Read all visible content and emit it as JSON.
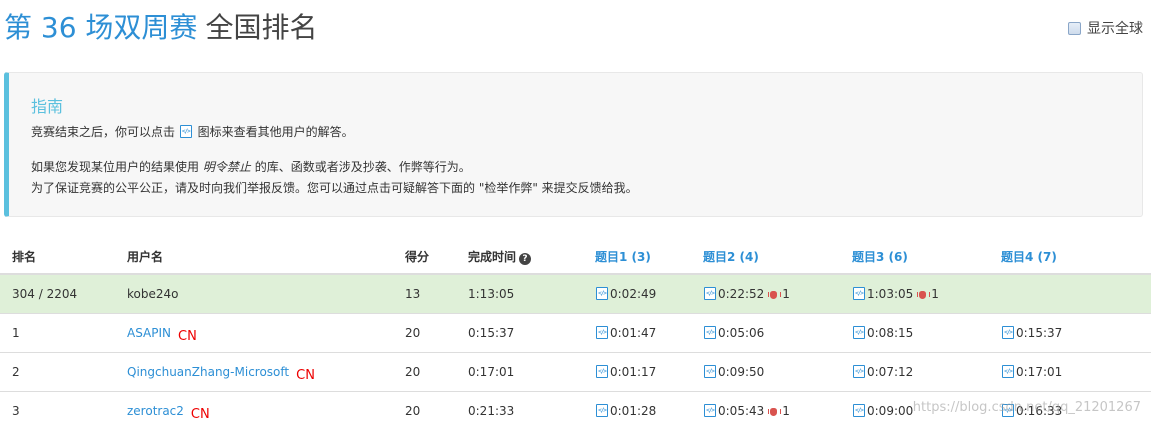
{
  "header": {
    "contest_title": "第 36 场双周赛",
    "rank_title": "全国排名",
    "show_global_label": "显示全球"
  },
  "guide": {
    "title": "指南",
    "line1_before": "竞赛结束之后，你可以点击",
    "line1_after": "图标来查看其他用户的解答。",
    "line2_before": "如果您发现某位用户的结果使用",
    "line2_em": "明令禁止",
    "line2_after": "的库、函数或者涉及抄袭、作弊等行为。",
    "line3": "为了保证竞赛的公平公正，请及时向我们举报反馈。您可以通过点击可疑解答下面的 \"检举作弊\" 来提交反馈给我。"
  },
  "table": {
    "headers": {
      "rank": "排名",
      "user": "用户名",
      "score": "得分",
      "finish_time": "完成时间",
      "q1": "题目1 (3)",
      "q2": "题目2 (4)",
      "q3": "题目3 (6)",
      "q4": "题目4 (7)"
    },
    "rows": [
      {
        "rank": "304 / 2204",
        "user": "kobe24o",
        "region": "",
        "score": "13",
        "time": "1:13:05",
        "q1": "0:02:49",
        "q1_bugs": "",
        "q2": "0:22:52",
        "q2_bugs": "1",
        "q3": "1:03:05",
        "q3_bugs": "1",
        "q4": "",
        "q4_bugs": ""
      },
      {
        "rank": "1",
        "user": "ASAPIN",
        "region": "CN",
        "score": "20",
        "time": "0:15:37",
        "q1": "0:01:47",
        "q1_bugs": "",
        "q2": "0:05:06",
        "q2_bugs": "",
        "q3": "0:08:15",
        "q3_bugs": "",
        "q4": "0:15:37",
        "q4_bugs": ""
      },
      {
        "rank": "2",
        "user": "QingchuanZhang-Microsoft",
        "region": "CN",
        "score": "20",
        "time": "0:17:01",
        "q1": "0:01:17",
        "q1_bugs": "",
        "q2": "0:09:50",
        "q2_bugs": "",
        "q3": "0:07:12",
        "q3_bugs": "",
        "q4": "0:17:01",
        "q4_bugs": ""
      },
      {
        "rank": "3",
        "user": "zerotrac2",
        "region": "CN",
        "score": "20",
        "time": "0:21:33",
        "q1": "0:01:28",
        "q1_bugs": "",
        "q2": "0:05:43",
        "q2_bugs": "1",
        "q3": "0:09:00",
        "q3_bugs": "",
        "q4": "0:16:33",
        "q4_bugs": ""
      }
    ]
  },
  "watermark": "https://blog.csdn.net/qq_21201267"
}
